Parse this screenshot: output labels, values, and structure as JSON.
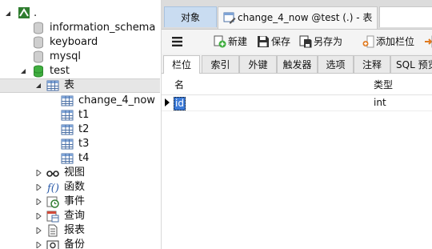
{
  "tree": {
    "root_label": ".",
    "databases": [
      "information_schema",
      "keyboard",
      "mysql"
    ],
    "open_db": "test",
    "tables_folder": "表",
    "tables": [
      "change_4_now",
      "t1",
      "t2",
      "t3",
      "t4"
    ],
    "folders": [
      "视图",
      "函数",
      "事件",
      "查询",
      "报表",
      "备份"
    ]
  },
  "tabs": {
    "objects": "对象",
    "document": "change_4_now @test (.) - 表"
  },
  "toolbar": {
    "new": "新建",
    "save": "保存",
    "save_as": "另存为",
    "add_column": "添加栏位"
  },
  "subtabs": [
    "栏位",
    "索引",
    "外键",
    "触发器",
    "选项",
    "注释",
    "SQL 预览"
  ],
  "grid": {
    "headers": [
      "名",
      "类型"
    ],
    "rows": [
      {
        "name": "id",
        "type": "int"
      }
    ]
  },
  "colors": {
    "selection": "#3d7bd8",
    "objects_tab": "#c9dcf1",
    "db_green": "#3fae3f"
  }
}
